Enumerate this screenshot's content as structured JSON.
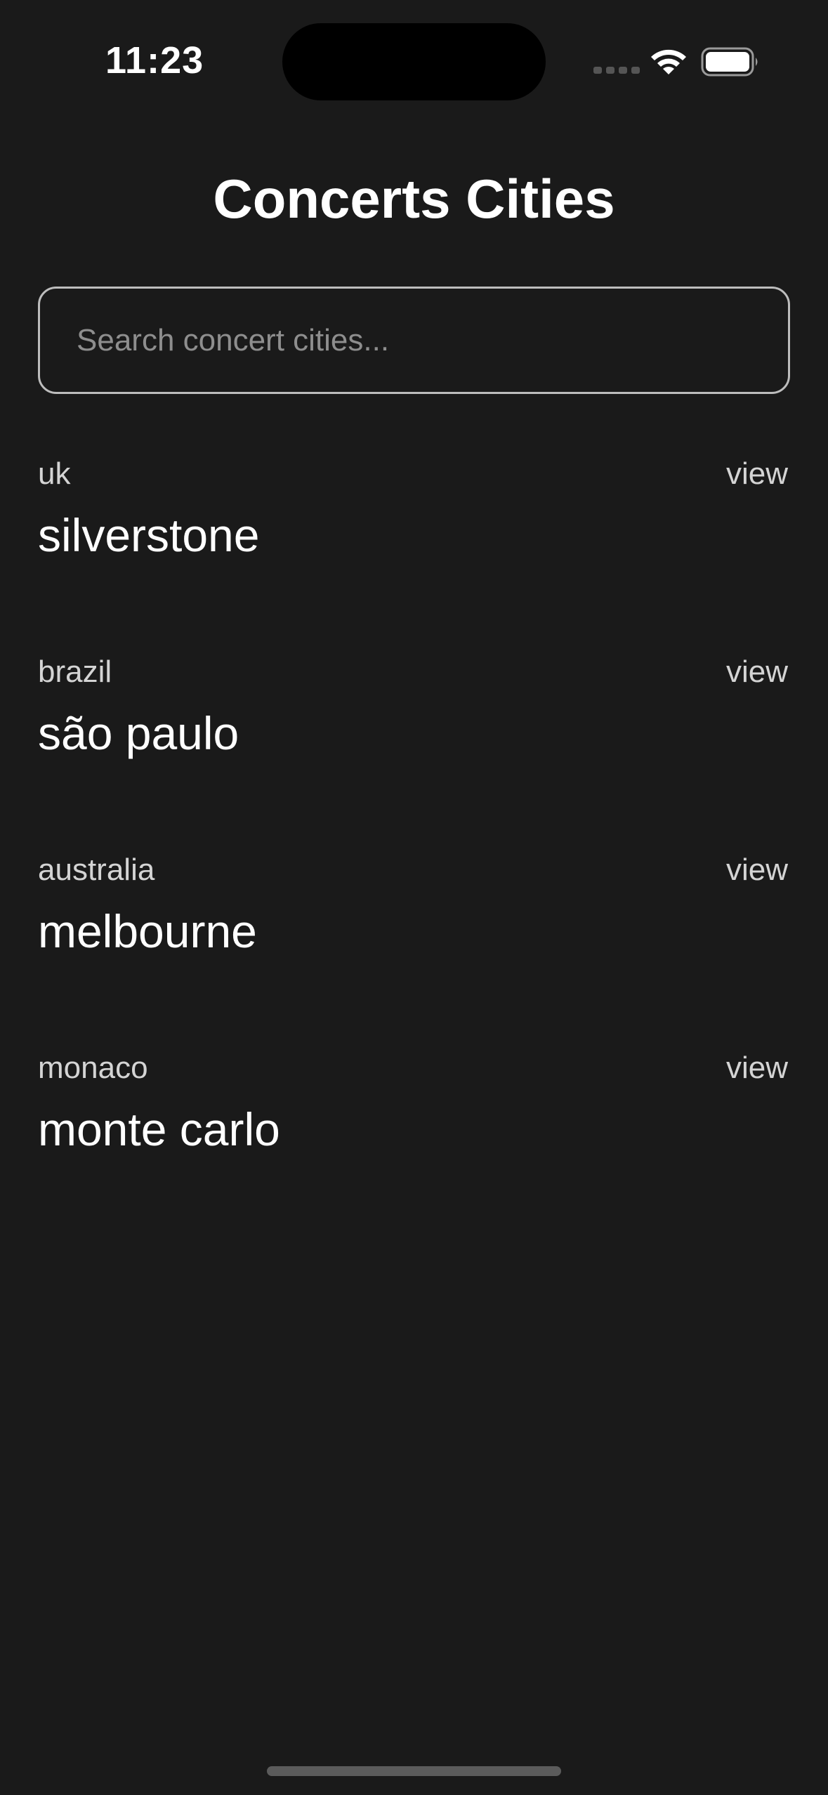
{
  "status_bar": {
    "time": "11:23"
  },
  "header": {
    "title": "Concerts Cities"
  },
  "search": {
    "placeholder": "Search concert cities...",
    "value": ""
  },
  "cities": [
    {
      "country": "uk",
      "city": "silverstone",
      "action": "view"
    },
    {
      "country": "brazil",
      "city": "são paulo",
      "action": "view"
    },
    {
      "country": "australia",
      "city": "melbourne",
      "action": "view"
    },
    {
      "country": "monaco",
      "city": "monte carlo",
      "action": "view"
    }
  ],
  "icons": {
    "wifi": "wifi-icon",
    "battery": "battery-icon",
    "signal": "signal-icon"
  },
  "colors": {
    "background": "#1a1a1a",
    "text_primary": "#ffffff",
    "text_secondary": "#d4d4d4",
    "placeholder": "#8e8e8e",
    "search_border": "#bdbdbd"
  }
}
